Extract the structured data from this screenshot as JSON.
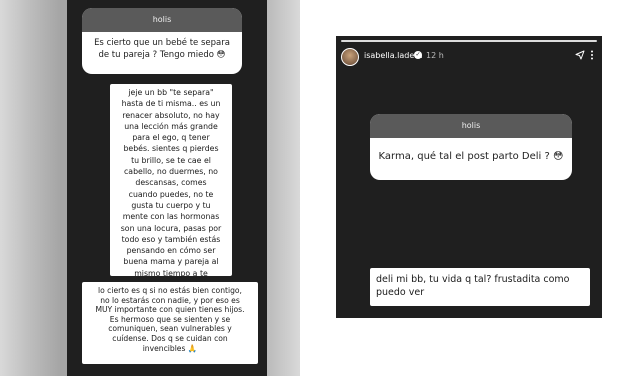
{
  "left_story": {
    "question_box": {
      "header": "holis",
      "text": "Es cierto que un bebé te separa de tu pareja ? Tengo miedo 😳"
    },
    "reply_1": "jeje un bb \"te separa\"\nhasta de ti misma.. es un\nrenacer absoluto, no hay\nuna lección más grande\npara el ego, q tener\nbebés. sientes q pierdes\ntu brillo, se te cae el\ncabello, no duermes, no\ndescansas, comes\ncuando puedes, no te\ngusta tu cuerpo y tu\nmente con las hormonas\nson una locura, pasas por\ntodo eso y también estás\npensando en cómo ser\nbuena mama y pareja al\nmismo tiempo a te\nsometes mal contigo.",
    "reply_2": "lo cierto es q si no estás bien contigo,\nno lo estarás con nadie, y por eso es\nMUY importante con quien tienes hijos.\nEs hermoso que se sienten y se\ncomuniquen, sean vulnerables y\ncuídense. Dos q se cuidan con\ninvencibles 🙏"
  },
  "right_story": {
    "header": {
      "username": "isabella.ladera",
      "verified_glyph": "✓",
      "time_ago": "12 h"
    },
    "question_box": {
      "header": "holis",
      "text": "Karma, qué tal el post parto Deli ? 😳"
    },
    "reply": "deli mi bb, tu vida q tal? frustadita como\npuedo ver"
  },
  "icons": {
    "send": "send-icon",
    "more": "more-options-icon",
    "verified": "verified-badge-icon"
  }
}
